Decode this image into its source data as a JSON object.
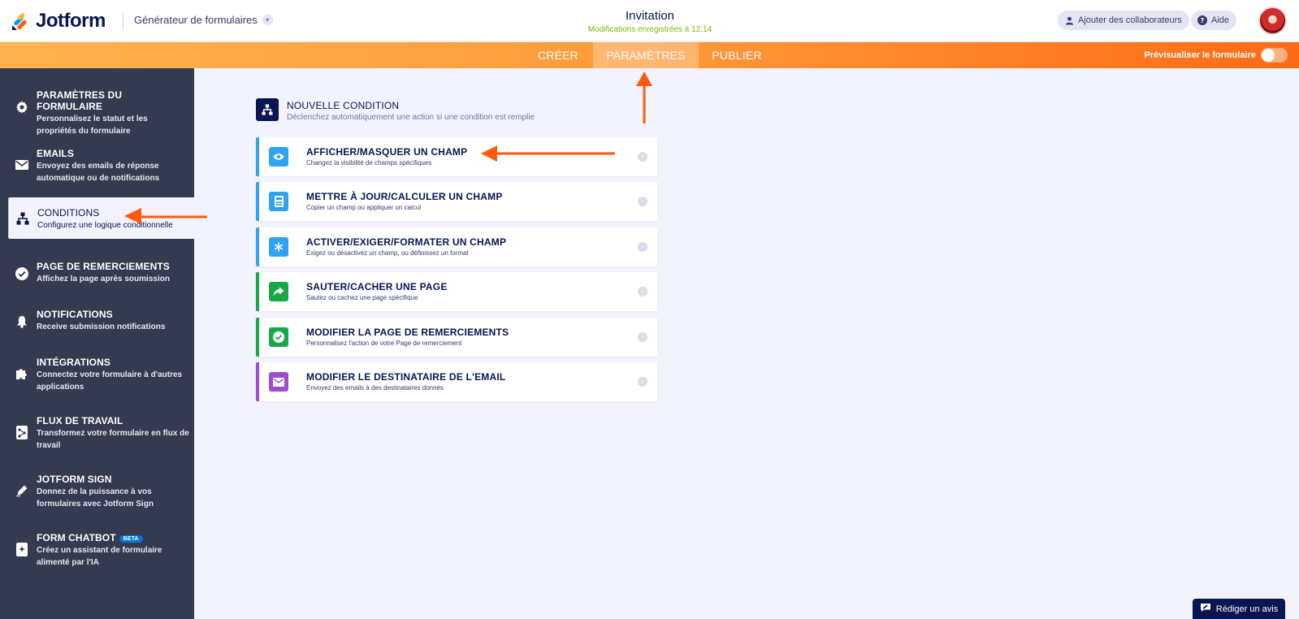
{
  "app": {
    "brand": "Jotform",
    "builder_label": "Générateur de formulaires",
    "form_title": "Invitation",
    "saved_status": "Modifications enregistrées à 12:14",
    "collaborators_label": "Ajouter des collaborateurs",
    "help_label": "Aide"
  },
  "nav": {
    "tabs": [
      {
        "label": "CRÉER",
        "active": false
      },
      {
        "label": "PARAMÈTRES",
        "active": true
      },
      {
        "label": "PUBLIER",
        "active": false
      }
    ],
    "preview_label": "Prévisualiser le formulaire",
    "preview_on": false
  },
  "sidebar": {
    "items": [
      {
        "icon": "gear-icon",
        "title": "PARAMÈTRES DU FORMULAIRE",
        "desc": "Personnalisez le statut et les propriétés du formulaire",
        "active": false
      },
      {
        "icon": "envelope-icon",
        "title": "EMAILS",
        "desc": "Envoyez des emails de réponse automatique ou de notifications",
        "active": false
      },
      {
        "icon": "sitemap-icon",
        "title": "CONDITIONS",
        "desc": "Configurez une logique conditionnelle",
        "active": true
      },
      {
        "icon": "check-circle-icon",
        "title": "PAGE DE REMERCIEMENTS",
        "desc": "Affichez la page après soumission",
        "active": false
      },
      {
        "icon": "bell-icon",
        "title": "NOTIFICATIONS",
        "desc": "Receive submission notifications",
        "active": false
      },
      {
        "icon": "puzzle-icon",
        "title": "INTÉGRATIONS",
        "desc": "Connectez votre formulaire à d'autres applications",
        "active": false
      },
      {
        "icon": "workflow-icon",
        "title": "FLUX DE TRAVAIL",
        "desc": "Transformez votre formulaire en flux de travail",
        "active": false
      },
      {
        "icon": "pen-icon",
        "title": "JOTFORM SIGN",
        "desc": "Donnez de la puissance à vos formulaires avec Jotform Sign",
        "active": false
      },
      {
        "icon": "chatbot-icon",
        "title": "FORM CHATBOT",
        "badge": "BETA",
        "desc": "Créez un assistant de formulaire alimenté par l'IA",
        "active": false
      }
    ]
  },
  "conditions": {
    "header_title": "NOUVELLE CONDITION",
    "header_desc": "Déclenchez automatiquement une action si une condition est remplie",
    "cards": [
      {
        "icon": "eye-icon",
        "color": "#2ea3f2",
        "title": "AFFICHER/MASQUER UN CHAMP",
        "desc": "Changez la visibilité de champs spécifiques"
      },
      {
        "icon": "calculator-icon",
        "color": "#2ea3f2",
        "title": "METTRE À JOUR/CALCULER UN CHAMP",
        "desc": "Copier un champ ou appliquer un calcul"
      },
      {
        "icon": "asterisk-icon",
        "color": "#2ea3f2",
        "title": "ACTIVER/EXIGER/FORMATER UN CHAMP",
        "desc": "Exigez ou désactivez un champ, ou définissez un format"
      },
      {
        "icon": "share-arrow-icon",
        "color": "#18a84a",
        "title": "SAUTER/CACHER UNE PAGE",
        "desc": "Sautez ou cachez une page spécifique"
      },
      {
        "icon": "check-icon",
        "color": "#18a84a",
        "title": "MODIFIER LA PAGE DE REMERCIEMENTS",
        "desc": "Personnalisez l'action de votre Page de remerciement"
      },
      {
        "icon": "mail-icon",
        "color": "#9c4dd3",
        "title": "MODIFIER LE DESTINATAIRE DE L'EMAIL",
        "desc": "Envoyez des emails à des destinataires donnés"
      }
    ]
  },
  "feedback_label": "Rédiger un avis",
  "colors": {
    "brand_navy": "#0a1551",
    "orange": "#ff6b16",
    "sidebar_bg": "#343a4f",
    "annotation_arrow": "#ff5a0f"
  }
}
